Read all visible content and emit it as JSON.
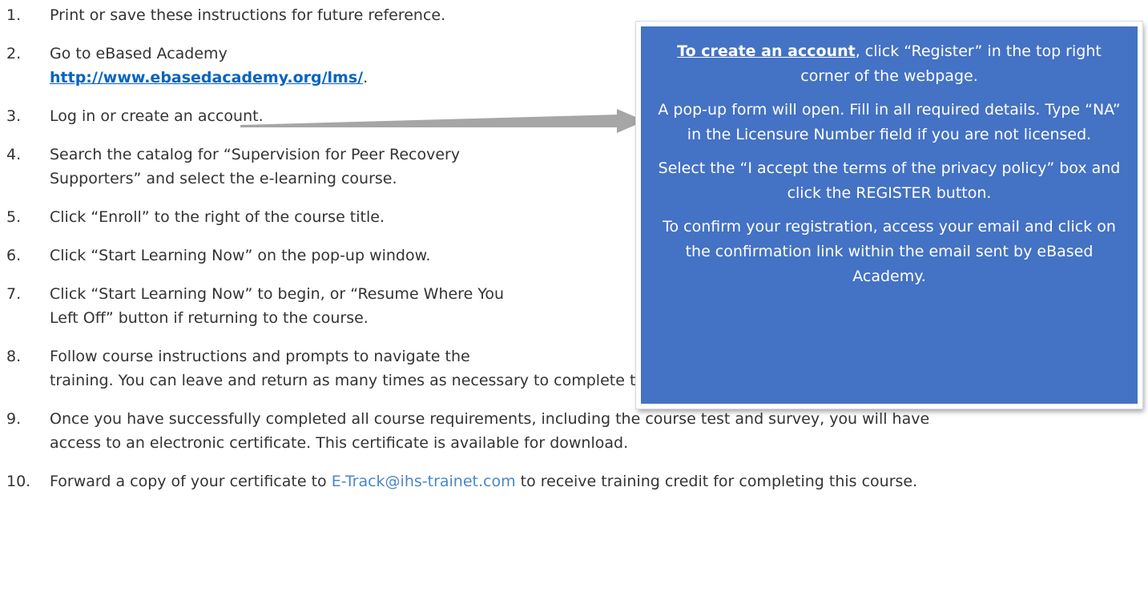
{
  "steps": [
    {
      "num": "1.",
      "text": "Print or save these instructions for future reference."
    },
    {
      "num": "2.",
      "text": "Go to eBased Academy",
      "url": "http://www.ebasedacademy.org/lms/",
      "after": "."
    },
    {
      "num": "3.",
      "text": "Log in or create an account."
    },
    {
      "num": "4.",
      "line1": "Search the catalog for “Supervision for Peer Recovery",
      "line2": "Supporters” and select the e-learning course."
    },
    {
      "num": "5.",
      "text": "Click “Enroll” to the right of the course title."
    },
    {
      "num": "6.",
      "text": "Click “Start Learning Now” on the pop-up window."
    },
    {
      "num": "7.",
      "line1": "Click “Start Learning Now” to begin, or “Resume Where You",
      "line2": "Left Off” button if returning to the course."
    },
    {
      "num": "8.",
      "line1": "Follow course instructions and prompts to navigate the",
      "line2": "training. You can leave and return as many times as necessary to complete the course."
    },
    {
      "num": "9.",
      "line1": "Once you have successfully completed all course requirements, including the course test and survey, you will have",
      "line2": "access to an electronic certificate. This certificate is available for download."
    },
    {
      "num": "10.",
      "before": "Forward a copy of your certificate to",
      "email": "E-Track@ihs-trainet.com",
      "after": "to receive training credit for completing this course."
    }
  ],
  "callout": {
    "lead": "To create an account",
    "p1_rest": ", click “Register” in the top right corner of the webpage.",
    "p2": "A pop-up form will open. Fill in all required details. Type “NA” in the Licensure Number field if you are not licensed.",
    "p3": "Select the “I accept the terms of the privacy policy” box and click the REGISTER button.",
    "p4": "To confirm your registration, access your email and click on the confirmation link within the email sent by eBased Academy."
  },
  "colors": {
    "callout_bg": "#4472c4",
    "link": "#0563c1",
    "email": "#4a86c8",
    "arrow": "#a6a6a6"
  }
}
